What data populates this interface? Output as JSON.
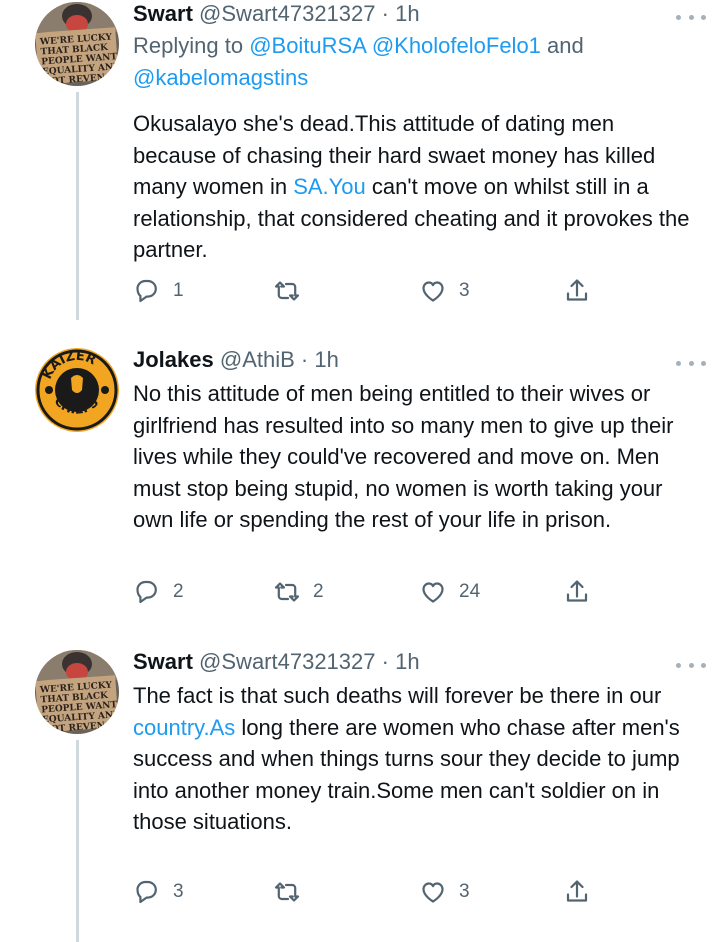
{
  "tweets": [
    {
      "name": "Swart",
      "handle": "@Swart47321327",
      "time": "1h",
      "replying_prefix": "Replying to ",
      "replying_users": [
        "@BoituRSA",
        "@KholofeloFelo1"
      ],
      "replying_and": " and",
      "replying_last": "@kabelomagstins",
      "text_parts": [
        "Okusalayo she's dead.This attitude of dating men because of chasing their hard swaet money has killed many women in ",
        "SA.You",
        " can't move on whilst still in a relationship, that considered cheating and it provokes the partner."
      ],
      "replies": "1",
      "retweets": "",
      "likes": "3",
      "avatar": "protest-sign-avatar"
    },
    {
      "name": "Jolakes",
      "handle": "@AthiB",
      "time": "1h",
      "text_parts": [
        "No this attitude of men being entitled to their wives or girlfriend has resulted into so many men to give up their lives while they could've recovered and move on. Men must stop being stupid, no women is worth taking your own life or spending the rest of your life in prison."
      ],
      "replies": "2",
      "retweets": "2",
      "likes": "24",
      "avatar": "kaizer-chiefs-logo-avatar",
      "avatar_text_top": "KAIZER",
      "avatar_text_bottom": "CHIEFS"
    },
    {
      "name": "Swart",
      "handle": "@Swart47321327",
      "time": "1h",
      "text_parts": [
        "The fact is that such deaths will forever be there in our ",
        "country.As",
        " long there are women who chase after men's success and when things turns sour they decide to jump into another money train.Some men can't soldier on in those situations."
      ],
      "replies": "3",
      "retweets": "",
      "likes": "3",
      "avatar": "protest-sign-avatar"
    }
  ],
  "dot_separator": "·",
  "sign_text": [
    "WE'RE LUCKY",
    "THAT BLACK",
    "PEOPLE WANT",
    "EQUALITY AND",
    "NOT REVENGE"
  ],
  "colors": {
    "link": "#1d9bf0",
    "muted": "#536471",
    "thread": "#cfd9de"
  }
}
